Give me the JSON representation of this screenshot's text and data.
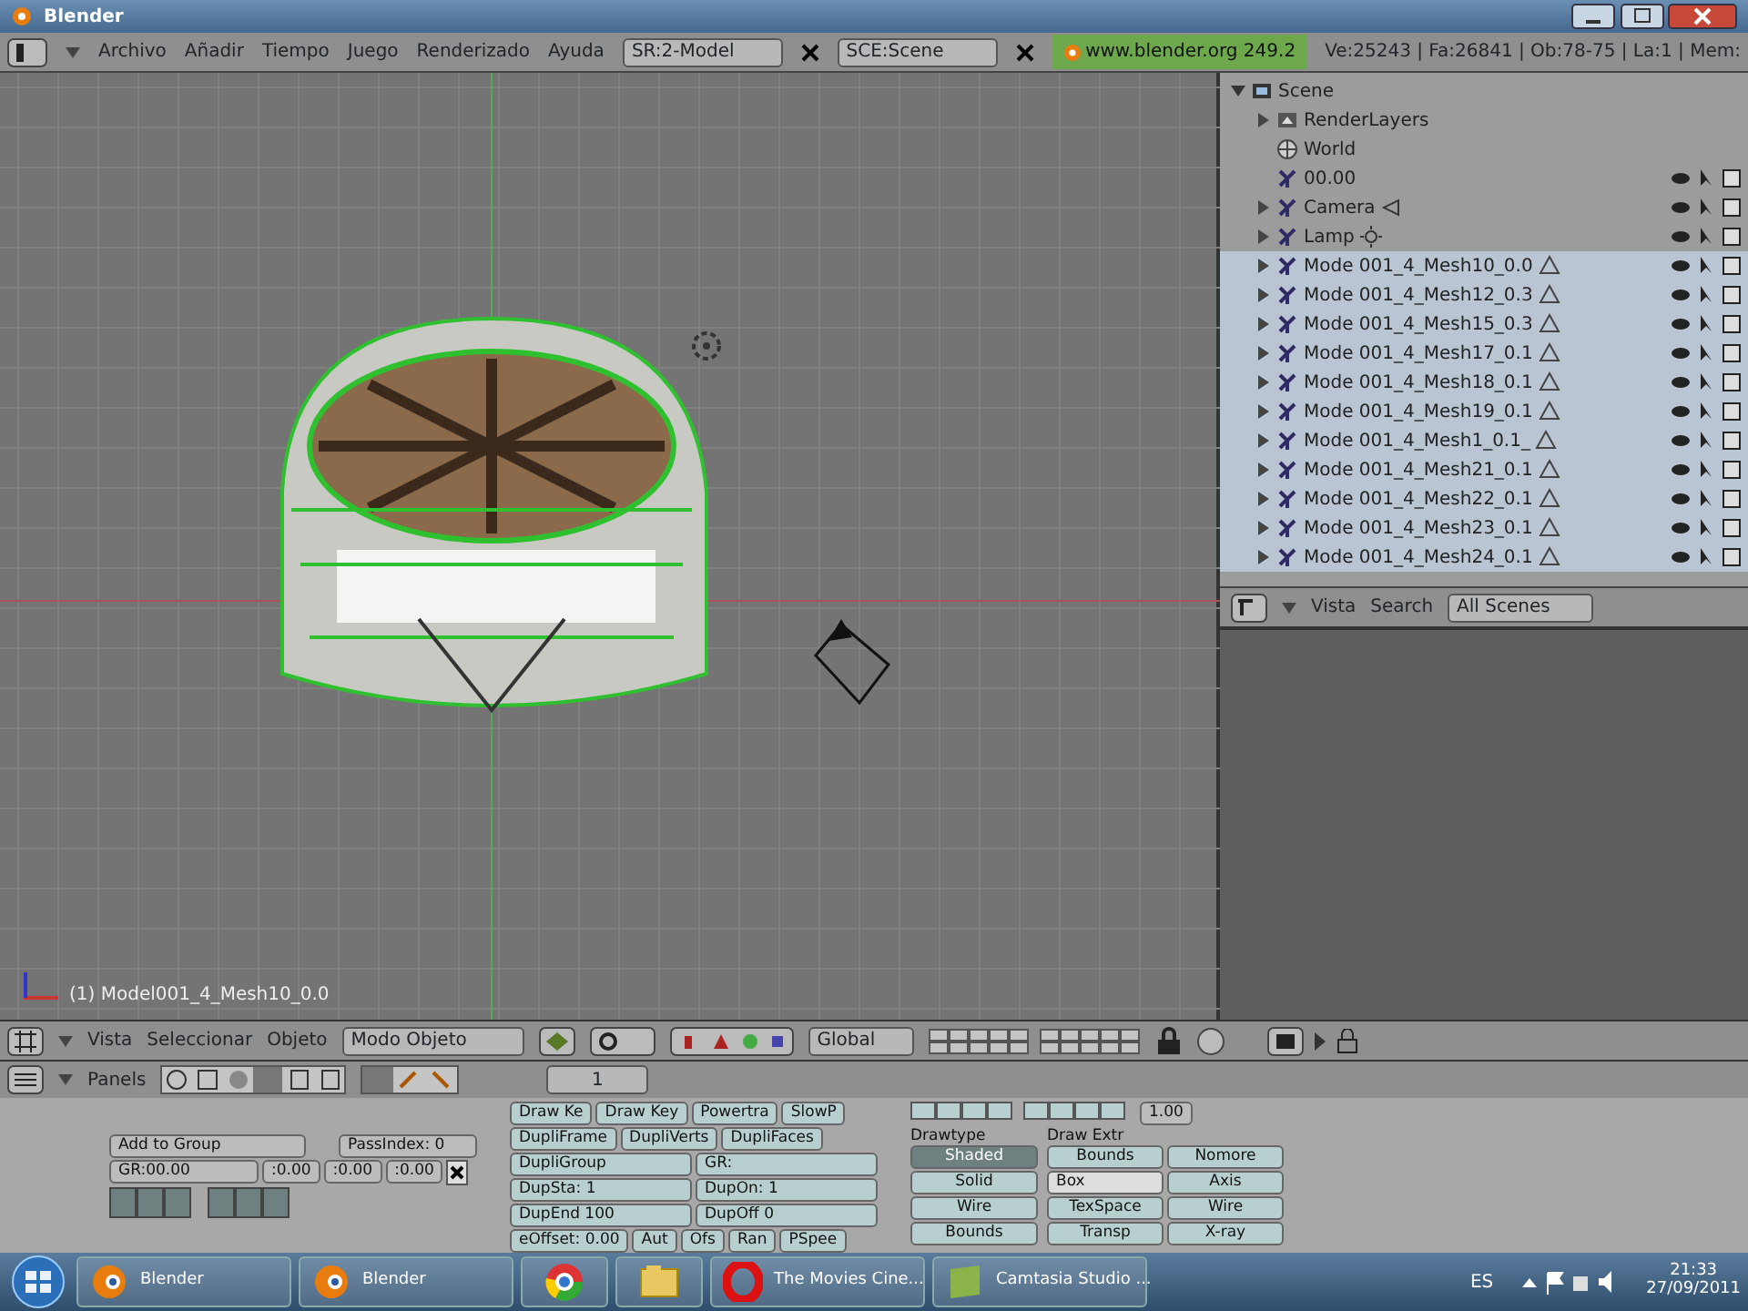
{
  "window": {
    "title": "Blender"
  },
  "menu_bar": {
    "menus": [
      "Archivo",
      "Añadir",
      "Tiempo",
      "Juego",
      "Renderizado",
      "Ayuda"
    ],
    "screen_field": "SR:2-Model",
    "scene_field": "SCE:Scene",
    "version_link": "www.blender.org 249.2",
    "stats": "Ve:25243 | Fa:26841 | Ob:78-75 | La:1 | Mem:"
  },
  "viewport": {
    "object_label": "(1) Model001_4_Mesh10_0.0"
  },
  "outliner": {
    "tree": [
      {
        "label": "Scene",
        "kind": "scene",
        "expanded": true,
        "selected": false,
        "children": [
          {
            "label": "RenderLayers",
            "kind": "renderlayers",
            "expanded": false,
            "selected": false,
            "restrict": false
          },
          {
            "label": "World",
            "kind": "world",
            "selected": false,
            "restrict": false
          },
          {
            "label": "00.00",
            "kind": "object",
            "selected": false,
            "restrict": true
          },
          {
            "label": "Camera",
            "kind": "camera",
            "expanded": false,
            "selected": false,
            "restrict": true
          },
          {
            "label": "Lamp",
            "kind": "lamp",
            "expanded": false,
            "selected": false,
            "restrict": true
          },
          {
            "label": "Mode 001_4_Mesh10_0.0",
            "kind": "mesh",
            "expanded": false,
            "selected": true,
            "restrict": true
          },
          {
            "label": "Mode 001_4_Mesh12_0.3",
            "kind": "mesh",
            "expanded": false,
            "selected": true,
            "restrict": true
          },
          {
            "label": "Mode 001_4_Mesh15_0.3",
            "kind": "mesh",
            "expanded": false,
            "selected": true,
            "restrict": true
          },
          {
            "label": "Mode 001_4_Mesh17_0.1",
            "kind": "mesh",
            "expanded": false,
            "selected": true,
            "restrict": true
          },
          {
            "label": "Mode 001_4_Mesh18_0.1",
            "kind": "mesh",
            "expanded": false,
            "selected": true,
            "restrict": true
          },
          {
            "label": "Mode 001_4_Mesh19_0.1",
            "kind": "mesh",
            "expanded": false,
            "selected": true,
            "restrict": true
          },
          {
            "label": "Mode 001_4_Mesh1_0.1_",
            "kind": "mesh",
            "expanded": false,
            "selected": true,
            "restrict": true
          },
          {
            "label": "Mode 001_4_Mesh21_0.1",
            "kind": "mesh",
            "expanded": false,
            "selected": true,
            "restrict": true
          },
          {
            "label": "Mode 001_4_Mesh22_0.1",
            "kind": "mesh",
            "expanded": false,
            "selected": true,
            "restrict": true
          },
          {
            "label": "Mode 001_4_Mesh23_0.1",
            "kind": "mesh",
            "expanded": false,
            "selected": true,
            "restrict": true
          },
          {
            "label": "Mode 001_4_Mesh24_0.1",
            "kind": "mesh",
            "expanded": false,
            "selected": true,
            "restrict": true
          }
        ]
      }
    ],
    "header": {
      "menus": [
        "Vista",
        "Search"
      ],
      "filter": "All Scenes"
    }
  },
  "view3d_header": {
    "menus": [
      "Vista",
      "Seleccionar",
      "Objeto"
    ],
    "mode": "Modo Objeto",
    "orientation": "Global"
  },
  "buttons_window": {
    "header": {
      "label": "Panels",
      "page": "1"
    },
    "object_panel": {
      "add_to_group": "Add to Group",
      "pass_index": "PassIndex: 0",
      "group_field": "GR:00.00",
      "offsets": [
        ":0.00",
        ":0.00",
        ":0.00"
      ]
    },
    "anim_panel": {
      "button_lines": [
        {
          "buttons": [
            "Draw Ke",
            "Draw Key",
            "Powertra",
            "SlowP"
          ]
        },
        {
          "buttons": [
            "DupliFrame",
            "DupliVerts",
            "DupliFaces"
          ]
        },
        {
          "buttons": [
            "DupliGroup",
            "GR:"
          ]
        },
        {
          "buttons": [
            "DupSta: 1",
            "DupOn: 1"
          ]
        },
        {
          "buttons": [
            "DupEnd 100",
            "DupOff 0"
          ]
        },
        {
          "buttons": [
            "eOffset: 0.00",
            "Aut",
            "Ofs",
            "Ran",
            "PSpee"
          ]
        }
      ]
    },
    "draw_panel": {
      "scale": "1.00",
      "drawtype_label": "Drawtype",
      "draw_extra_label": "Draw Extr",
      "drawtypes": [
        {
          "label": "Shaded",
          "selected": true
        },
        {
          "label": "Solid",
          "selected": false
        },
        {
          "label": "Wire",
          "selected": false
        },
        {
          "label": "Bounds",
          "selected": false
        }
      ],
      "extras": [
        {
          "label": "Bounds",
          "kind": "toggle"
        },
        {
          "label": "Nomore",
          "kind": "toggle"
        },
        {
          "label": "Box",
          "kind": "dropdown"
        },
        {
          "label": "Axis",
          "kind": "toggle"
        },
        {
          "label": "TexSpace",
          "kind": "toggle"
        },
        {
          "label": "Wire",
          "kind": "toggle"
        },
        {
          "label": "Transp",
          "kind": "toggle"
        },
        {
          "label": "X-ray",
          "kind": "toggle"
        }
      ]
    }
  },
  "taskbar": {
    "items": [
      {
        "label": "Blender",
        "kind": "blender"
      },
      {
        "label": "Blender",
        "kind": "blender"
      },
      {
        "kind": "browser"
      },
      {
        "kind": "folder"
      },
      {
        "label": "The Movies Cine...",
        "kind": "opera"
      },
      {
        "label": "Camtasia Studio ...",
        "kind": "camtasia"
      }
    ],
    "language": "ES",
    "time": "21:33",
    "date": "27/09/2011"
  }
}
